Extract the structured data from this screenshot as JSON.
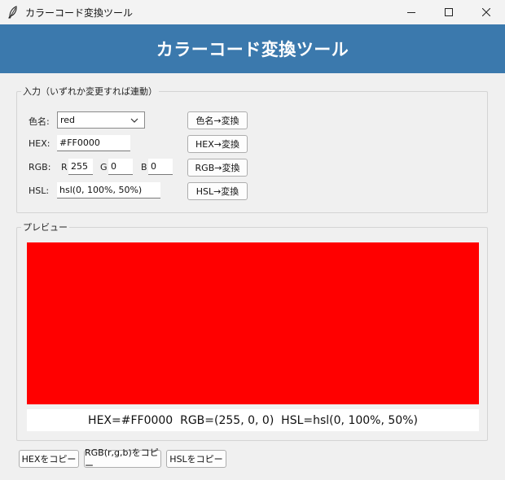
{
  "window": {
    "title": "カラーコード変換ツール",
    "icon": "feather-icon"
  },
  "header": {
    "title": "カラーコード変換ツール"
  },
  "input_group": {
    "legend": "入力（いずれか変更すれば連動）",
    "color_name": {
      "label": "色名:",
      "value": "red",
      "button": "色名→変換"
    },
    "hex": {
      "label": "HEX:",
      "value": "#FF0000",
      "button": "HEX→変換"
    },
    "rgb": {
      "label": "RGB:",
      "r_label": "R",
      "r": "255",
      "g_label": "G",
      "g": "0",
      "b_label": "B",
      "b": "0",
      "button": "RGB→変換"
    },
    "hsl": {
      "label": "HSL:",
      "value": "hsl(0, 100%, 50%)",
      "button": "HSL→変換"
    }
  },
  "preview_group": {
    "legend": "プレビュー",
    "swatch_color": "#FF0000",
    "info": "HEX=#FF0000  RGB=(255, 0, 0)  HSL=hsl(0, 100%, 50%)"
  },
  "copy_buttons": {
    "hex": "HEXをコピー",
    "rgb": "RGB(r,g,b)をコピー",
    "hsl": "HSLをコピー"
  },
  "colors": {
    "header_bg": "#3B79AD",
    "header_text": "#FFFFFF",
    "window_bg": "#F0F0F0"
  }
}
